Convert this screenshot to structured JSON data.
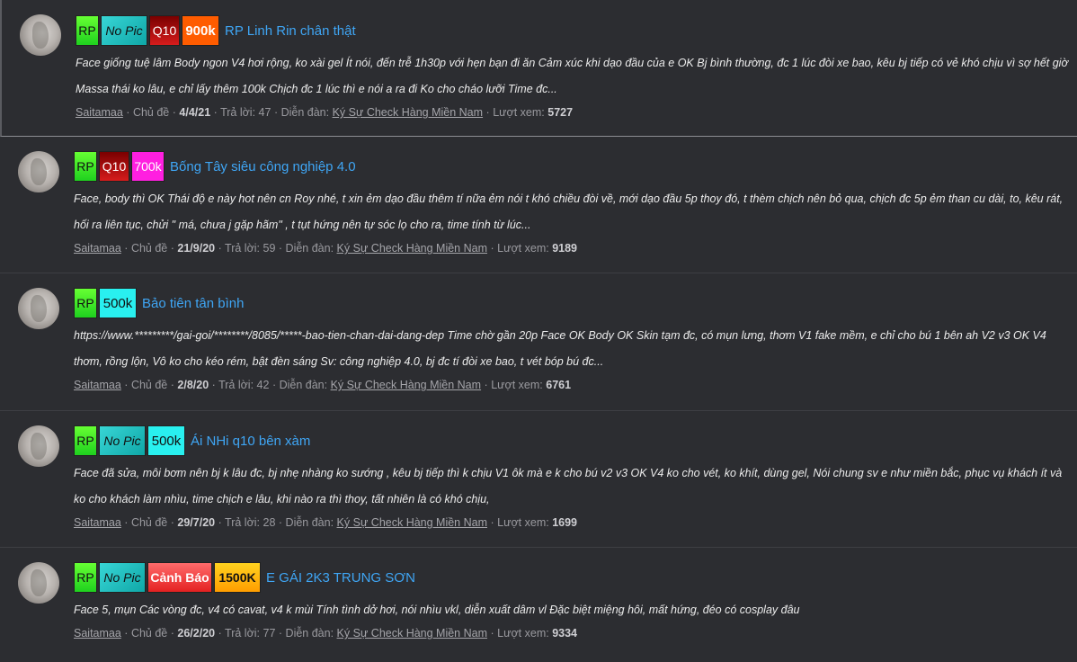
{
  "labels": {
    "thread_starter": "Chủ đề",
    "replies": "Trả lời:",
    "forum": "Diễn đàn:",
    "views": "Lượt xem:",
    "sep": "·"
  },
  "threads": [
    {
      "tags": [
        "RP",
        "No Pic",
        "Q10",
        "900k"
      ],
      "title": "RP Linh Rin chân thật",
      "snippet": "Face giống tuệ lâm Body ngon V4 hơi rộng, ko xài gel Ít nói, đến trễ 1h30p với hẹn bạn đi ăn Cảm xúc khi dạo đầu của e OK Bj bình thường, đc 1 lúc đòi xe bao, kêu bj tiếp có vẻ khó chịu vì sợ hết giờ Massa thái ko lâu, e chỉ lấy thêm 100k Chịch đc 1 lúc thì e nói a ra đi Ko cho cháo lưỡi Time đc...",
      "author": "Saitamaa",
      "date": "4/4/21",
      "replies": "47",
      "forum": "Ký Sự Check Hàng Miền Nam",
      "views": "5727"
    },
    {
      "tags": [
        "RP",
        "Q10",
        "700k"
      ],
      "title": "Bống Tây siêu công nghiệp 4.0",
      "snippet": "Face, body thì OK Thái độ e này hot nên cn Roy nhé, t xin ẻm dạo đầu thêm tí nữa ẻm nói t khó chiều đòi về, mới dạo đầu 5p thoy đó, t thèm chịch nên bỏ qua, chịch đc 5p ẻm than cu dài, to, kêu rát, hối ra liên tục, chửi \" má, chưa j gặp hãm\" , t tụt hứng nên tự sóc lọ cho ra, time tính từ lúc...",
      "author": "Saitamaa",
      "date": "21/9/20",
      "replies": "59",
      "forum": "Ký Sự Check Hàng Miền Nam",
      "views": "9189"
    },
    {
      "tags": [
        "RP",
        "500k"
      ],
      "title": "Bảo tiên tân bình",
      "snippet": "https://www.*********/gai-goi/********/8085/*****-bao-tien-chan-dai-dang-dep Time chờ gần 20p Face OK Body OK Skin tạm đc, có mụn lưng, thơm V1 fake mềm, e chỉ cho bú 1 bên ah V2 v3 OK V4 thơm, rồng lộn, Vô ko cho kéo rém, bật đèn sáng Sv: công nghiệp 4.0, bj đc tí đòi xe bao, t vét bóp bú đc...",
      "author": "Saitamaa",
      "date": "2/8/20",
      "replies": "42",
      "forum": "Ký Sự Check Hàng Miền Nam",
      "views": "6761"
    },
    {
      "tags": [
        "RP",
        "No Pic",
        "500k"
      ],
      "title": "Ái NHi q10 bên xàm",
      "snippet": "Face đã sửa, môi bơm nên bj k lâu đc, bj nhẹ nhàng ko sướng , kêu bj tiếp thì k chịu V1 ôk mà e k cho bú v2 v3 OK V4 ko cho vét, ko khít, dùng gel, Nói chung sv e như miền bắc, phục vụ khách ít và ko cho khách làm nhìu, time chịch e lâu, khi nào ra thì thoy, tất nhiên là có khó chịu,",
      "author": "Saitamaa",
      "date": "29/7/20",
      "replies": "28",
      "forum": "Ký Sự Check Hàng Miền Nam",
      "views": "1699"
    },
    {
      "tags": [
        "RP",
        "No Pic",
        "Cảnh Báo",
        "1500K"
      ],
      "title": "E GÁI 2K3 TRUNG SƠN",
      "snippet": "Face 5, mụn Các vòng đc, v4 có cavat, v4 k mùi Tính tình dở hơi, nói nhìu vkl, diễn xuất dâm vl Đặc biệt miệng hôi, mất hứng, đéo có cosplay đâu",
      "author": "Saitamaa",
      "date": "26/2/20",
      "replies": "77",
      "forum": "Ký Sự Check Hàng Miền Nam",
      "views": "9334"
    }
  ]
}
